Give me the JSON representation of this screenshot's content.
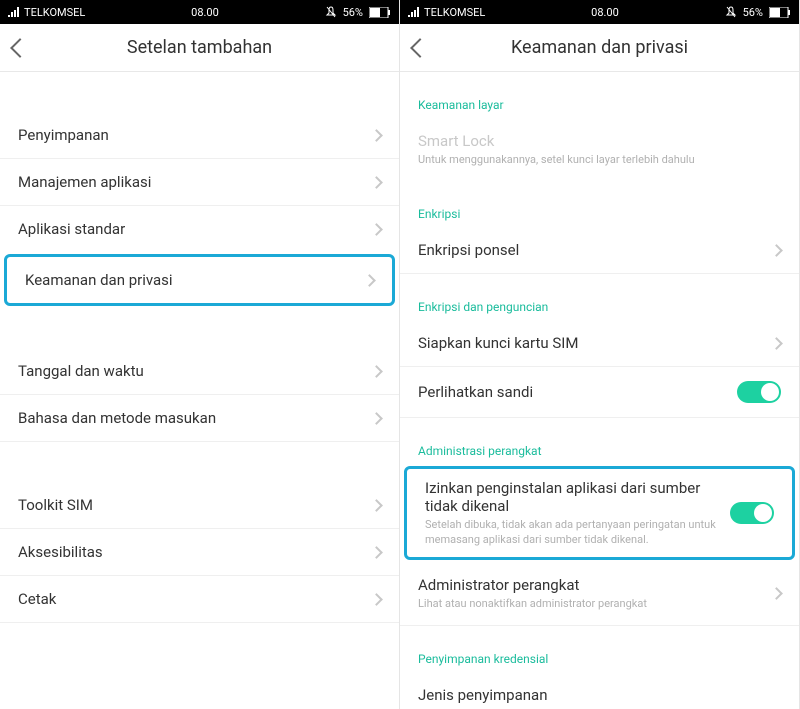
{
  "statusbar": {
    "carrier": "TELKOMSEL",
    "time": "08.00",
    "battery": "56%"
  },
  "left": {
    "title": "Setelan tambahan",
    "items": {
      "storage": "Penyimpanan",
      "app_mgmt": "Manajemen aplikasi",
      "default_apps": "Aplikasi standar",
      "security": "Keamanan dan privasi",
      "date_time": "Tanggal dan waktu",
      "lang_input": "Bahasa dan metode masukan",
      "sim_toolkit": "Toolkit SIM",
      "accessibility": "Aksesibilitas",
      "print": "Cetak"
    }
  },
  "right": {
    "title": "Keamanan dan privasi",
    "sections": {
      "screen_security": "Keamanan layar",
      "encryption": "Enkripsi",
      "encrypt_lock": "Enkripsi dan penguncian",
      "device_admin": "Administrasi perangkat",
      "cred_storage": "Penyimpanan kredensial"
    },
    "items": {
      "smart_lock": {
        "label": "Smart Lock",
        "sub": "Untuk menggunakannya, setel kunci layar terlebih dahulu"
      },
      "encrypt_phone": "Enkripsi ponsel",
      "sim_lock": "Siapkan kunci kartu SIM",
      "show_password": "Perlihatkan sandi",
      "unknown_sources": {
        "label": "Izinkan penginstalan aplikasi dari sumber tidak dikenal",
        "sub": "Setelah dibuka, tidak akan ada pertanyaan peringatan untuk memasang aplikasi dari sumber tidak dikenal."
      },
      "device_admin_row": {
        "label": "Administrator perangkat",
        "sub": "Lihat atau nonaktifkan administrator perangkat"
      },
      "storage_type": "Jenis penyimpanan"
    }
  }
}
